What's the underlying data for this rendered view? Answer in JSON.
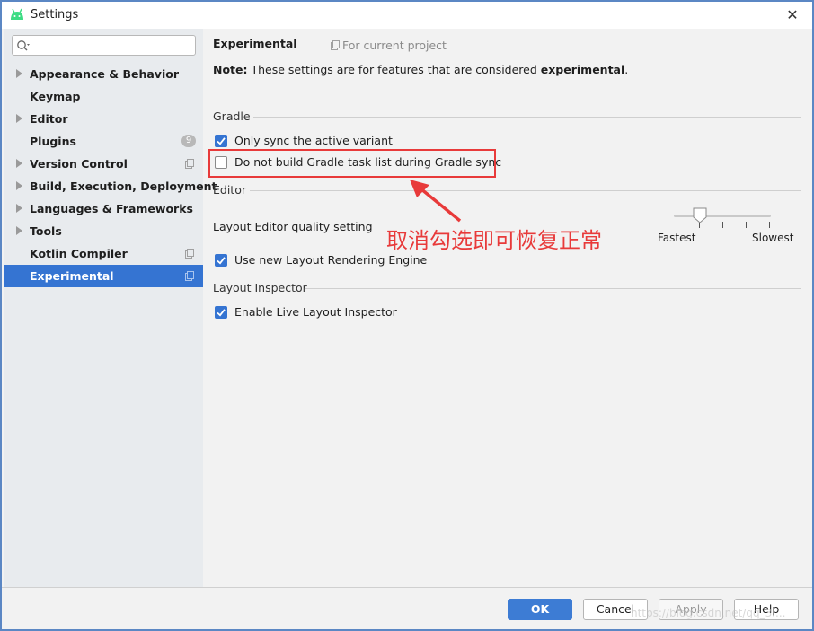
{
  "window": {
    "title": "Settings",
    "close_glyph": "✕"
  },
  "search": {
    "placeholder": "",
    "value": ""
  },
  "sidebar": {
    "items": [
      {
        "label": "Appearance & Behavior",
        "expandable": true
      },
      {
        "label": "Keymap",
        "expandable": false
      },
      {
        "label": "Editor",
        "expandable": true
      },
      {
        "label": "Plugins",
        "expandable": false,
        "badge": "9"
      },
      {
        "label": "Version Control",
        "expandable": true
      },
      {
        "label": "Build, Execution, Deployment",
        "expandable": true
      },
      {
        "label": "Languages & Frameworks",
        "expandable": true
      },
      {
        "label": "Tools",
        "expandable": true
      },
      {
        "label": "Kotlin Compiler",
        "expandable": false
      },
      {
        "label": "Experimental",
        "expandable": false,
        "selected": true
      }
    ]
  },
  "content": {
    "title": "Experimental",
    "scope": "For current project",
    "note_prefix": "Note:",
    "note_text": " These settings are for features that are considered ",
    "note_emphasis": "experimental",
    "note_suffix": ".",
    "sections": {
      "gradle": "Gradle",
      "editor": "Editor",
      "layout_inspector": "Layout Inspector"
    },
    "options": {
      "only_sync_active_variant": {
        "label": "Only sync the active variant",
        "checked": true
      },
      "do_not_build_gradle_task_list": {
        "label": "Do not build Gradle task list during Gradle sync",
        "checked": false
      },
      "use_new_layout_rendering": {
        "label": "Use new Layout Rendering Engine",
        "checked": true
      },
      "enable_live_layout_inspector": {
        "label": "Enable Live Layout Inspector",
        "checked": true
      }
    },
    "quality": {
      "label": "Layout Editor quality setting",
      "min_label": "Fastest",
      "max_label": "Slowest",
      "level_fraction": 0.25
    }
  },
  "annotation": {
    "text": "取消勾选即可恢复正常",
    "color": "#e83a3a"
  },
  "footer": {
    "ok_label": "OK",
    "cancel_label": "Cancel",
    "apply_label": "Apply",
    "help_label": "Help",
    "watermark": "https://blog.csdn.net/qq_3...."
  },
  "colors": {
    "accent": "#3574d2",
    "android_green": "#3ddc84"
  }
}
